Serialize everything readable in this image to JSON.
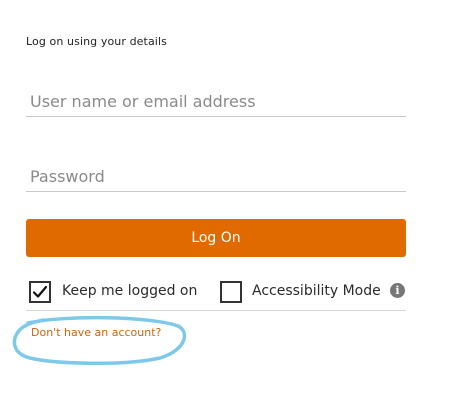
{
  "login": {
    "heading": "Log on using your details",
    "username_placeholder": "User name or email address",
    "username_value": "",
    "password_placeholder": "Password",
    "password_value": "",
    "logon_label": "Log On",
    "keep_logged_label": "Keep me logged on",
    "keep_logged_checked": true,
    "accessibility_label": "Accessibility Mode",
    "accessibility_checked": false,
    "info_glyph": "i",
    "account_link": "Don't have an account?"
  },
  "colors": {
    "accent": "#e06a00",
    "link": "#c8650d",
    "highlight_circle": "#7ec8ea"
  },
  "icons": {
    "info": "info-icon",
    "check": "checkmark-icon"
  }
}
